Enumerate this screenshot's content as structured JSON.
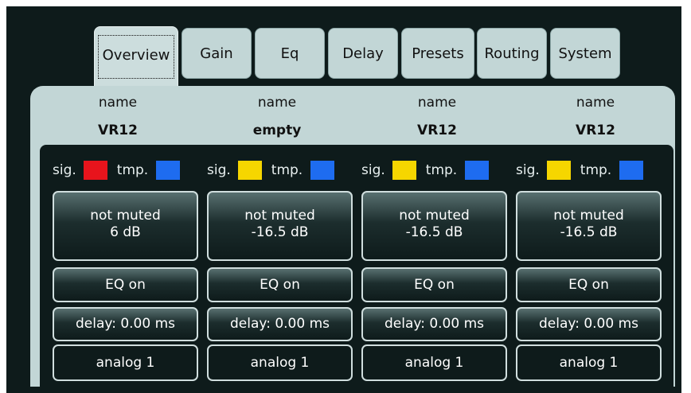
{
  "tabs": [
    "Overview",
    "Gain",
    "Eq",
    "Delay",
    "Presets",
    "Routing",
    "System"
  ],
  "active_tab": "Overview",
  "colors": {
    "red": "#e8141c",
    "yellow": "#f6d600",
    "blue": "#1e6cf0",
    "panel": "#c2d6d6",
    "background": "#0e1b1b"
  },
  "channels": [
    {
      "name_label": "name",
      "name": "VR12",
      "sig_label": "sig.",
      "sig_color": "#e8141c",
      "tmp_label": "tmp.",
      "tmp_color": "#1e6cf0",
      "mute_state": "not muted",
      "gain": "6 dB",
      "eq": "EQ on",
      "delay": "delay: 0.00 ms",
      "source": "analog 1"
    },
    {
      "name_label": "name",
      "name": "empty",
      "sig_label": "sig.",
      "sig_color": "#f6d600",
      "tmp_label": "tmp.",
      "tmp_color": "#1e6cf0",
      "mute_state": "not muted",
      "gain": "-16.5 dB",
      "eq": "EQ on",
      "delay": "delay: 0.00 ms",
      "source": "analog 1"
    },
    {
      "name_label": "name",
      "name": "VR12",
      "sig_label": "sig.",
      "sig_color": "#f6d600",
      "tmp_label": "tmp.",
      "tmp_color": "#1e6cf0",
      "mute_state": "not muted",
      "gain": "-16.5 dB",
      "eq": "EQ on",
      "delay": "delay: 0.00 ms",
      "source": "analog 1"
    },
    {
      "name_label": "name",
      "name": "VR12",
      "sig_label": "sig.",
      "sig_color": "#f6d600",
      "tmp_label": "tmp.",
      "tmp_color": "#1e6cf0",
      "mute_state": "not muted",
      "gain": "-16.5 dB",
      "eq": "EQ on",
      "delay": "delay: 0.00 ms",
      "source": "analog 1"
    }
  ]
}
